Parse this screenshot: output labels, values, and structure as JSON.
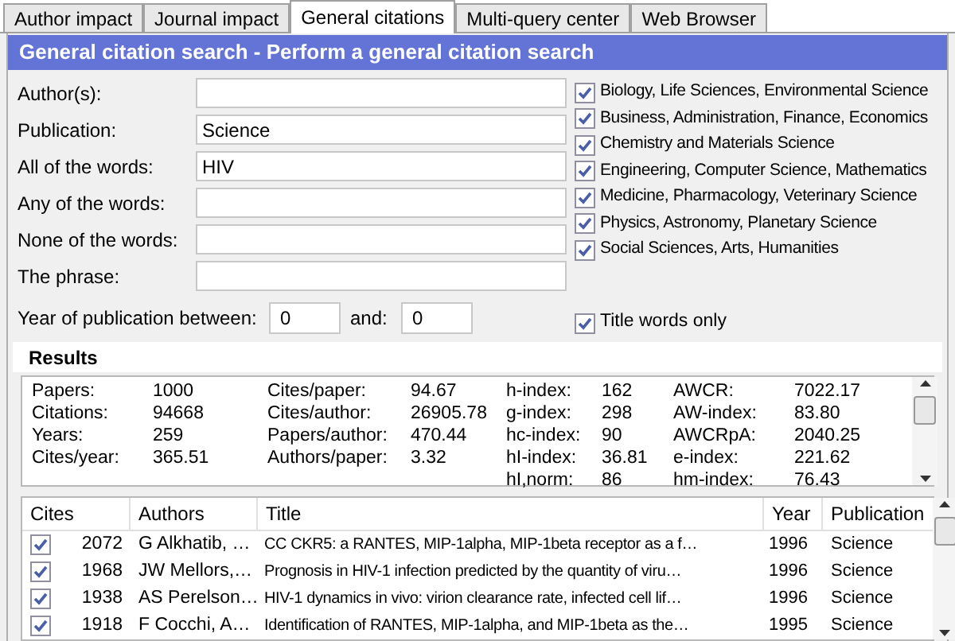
{
  "tabs": [
    {
      "label": "Author impact",
      "selected": false
    },
    {
      "label": "Journal impact",
      "selected": false
    },
    {
      "label": "General citations",
      "selected": true
    },
    {
      "label": "Multi-query center",
      "selected": false
    },
    {
      "label": "Web Browser",
      "selected": false
    }
  ],
  "header": "General citation search - Perform a general citation search",
  "fields": [
    {
      "label": "Author(s):"
    },
    {
      "label": "Publication:",
      "value": "Science"
    },
    {
      "label": "All of the words:",
      "value": "HIV"
    },
    {
      "label": "Any of the words:"
    },
    {
      "label": "None of the words:"
    },
    {
      "label": "The phrase:"
    }
  ],
  "year_range": {
    "label": "Year of publication between:",
    "from": "0",
    "and_label": "and:",
    "to": "0"
  },
  "subjects": [
    {
      "label": "Biology, Life Sciences, Environmental Science",
      "checked": true
    },
    {
      "label": "Business, Administration, Finance, Economics",
      "checked": true
    },
    {
      "label": "Chemistry and Materials Science",
      "checked": true
    },
    {
      "label": "Engineering, Computer Science, Mathematics",
      "checked": true
    },
    {
      "label": "Medicine, Pharmacology, Veterinary Science",
      "checked": true
    },
    {
      "label": "Physics, Astronomy, Planetary Science",
      "checked": true
    },
    {
      "label": "Social Sciences, Arts, Humanities",
      "checked": true
    }
  ],
  "title_words_only": {
    "label": "Title words only",
    "checked": true
  },
  "results": {
    "title": "Results",
    "columns": [
      [
        [
          "Papers:",
          "1000"
        ],
        [
          "Citations:",
          "94668"
        ],
        [
          "Years:",
          "259"
        ],
        [
          "Cites/year:",
          "365.51"
        ]
      ],
      [
        [
          "Cites/paper:",
          "94.67"
        ],
        [
          "Cites/author:",
          "26905.78"
        ],
        [
          "Papers/author:",
          "470.44"
        ],
        [
          "Authors/paper:",
          "3.32"
        ]
      ],
      [
        [
          "h-index:",
          "162"
        ],
        [
          "g-index:",
          "298"
        ],
        [
          "hc-index:",
          "90"
        ],
        [
          "hI-index:",
          "36.81"
        ],
        [
          "hI,norm:",
          "86"
        ]
      ],
      [
        [
          "AWCR:",
          "7022.17"
        ],
        [
          "AW-index:",
          "83.80"
        ],
        [
          "AWCRpA:",
          "2040.25"
        ],
        [
          "e-index:",
          "221.62"
        ],
        [
          "hm-index:",
          "76.43"
        ]
      ]
    ]
  },
  "table": {
    "columns": [
      "Cites",
      "Authors",
      "Title",
      "Year",
      "Publication"
    ],
    "rows": [
      {
        "checked": true,
        "cites": "2072",
        "authors": "G Alkhatib, …",
        "title": "CC CKR5: a RANTES, MIP-1alpha, MIP-1beta receptor as a f…",
        "year": "1996",
        "publication": "Science"
      },
      {
        "checked": true,
        "cites": "1968",
        "authors": "JW Mellors,…",
        "title": "Prognosis in HIV-1 infection predicted by the quantity of viru…",
        "year": "1996",
        "publication": "Science"
      },
      {
        "checked": true,
        "cites": "1938",
        "authors": "AS Perelson…",
        "title": "HIV-1 dynamics in vivo: virion clearance rate, infected cell lif…",
        "year": "1996",
        "publication": "Science"
      },
      {
        "checked": true,
        "cites": "1918",
        "authors": "F Cocchi, A…",
        "title": "Identification of RANTES, MIP-1alpha, and MIP-1beta as the…",
        "year": "1995",
        "publication": "Science"
      }
    ]
  }
}
